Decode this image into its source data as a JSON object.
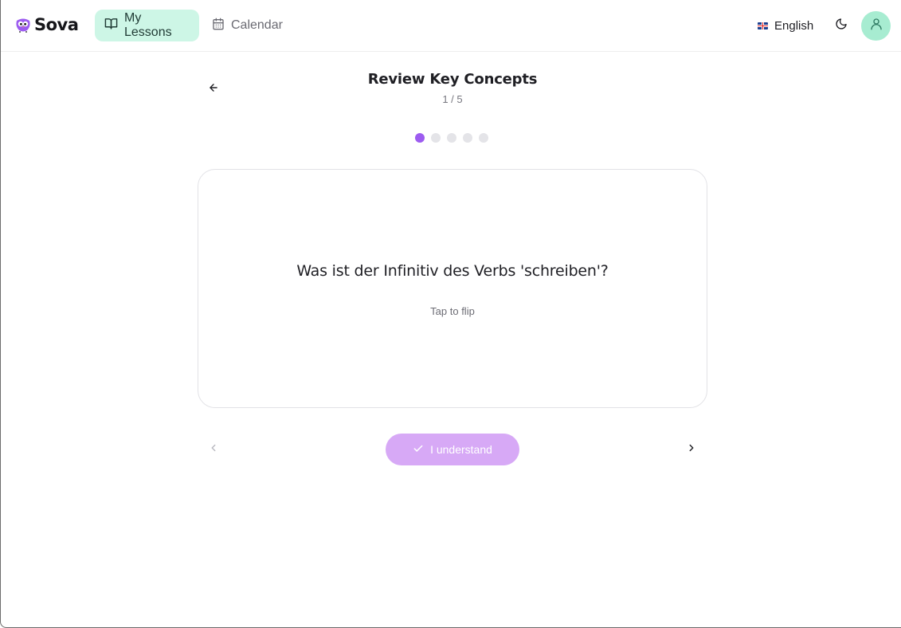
{
  "header": {
    "logo_text": "Sova",
    "nav": [
      {
        "label": "My Lessons",
        "icon": "book-open-icon",
        "active": true
      },
      {
        "label": "Calendar",
        "icon": "calendar-icon",
        "active": false
      }
    ],
    "language": {
      "label": "English",
      "icon": "uk-flag-icon"
    },
    "theme_toggle_icon": "moon-icon",
    "avatar_icon": "user-icon"
  },
  "lesson": {
    "title": "Review Key Concepts",
    "counter": "1 / 5",
    "progress": {
      "total": 5,
      "current": 1
    }
  },
  "card": {
    "question": "Was ist der Infinitiv des Verbs 'schreiben'?",
    "hint": "Tap to flip"
  },
  "controls": {
    "understand_label": "I understand",
    "prev_icon": "chevron-left-icon",
    "next_icon": "chevron-right-icon",
    "back_icon": "arrow-left-icon"
  },
  "colors": {
    "accent": "#9d5cf0",
    "accent_light": "#d7a9f6",
    "nav_active_bg": "#cdf6e6",
    "avatar_bg": "#a7ecd1"
  }
}
